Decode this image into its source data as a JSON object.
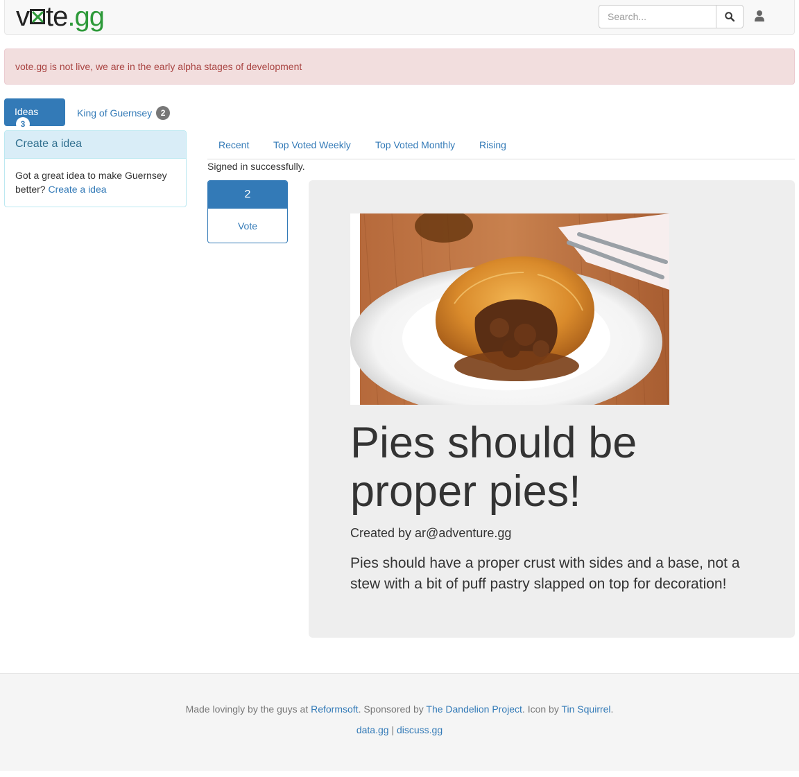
{
  "navbar": {
    "logo_prefix": "v",
    "logo_suffix": "te",
    "logo_tld": ".gg",
    "search_placeholder": "Search...",
    "search_icon": "search-icon",
    "user_icon": "user-icon"
  },
  "alert": {
    "message": "vote.gg is not live, we are in the early alpha stages of development"
  },
  "pills": {
    "ideas_label": "Ideas",
    "ideas_count": "3",
    "king_label": "King of Guernsey",
    "king_count": "2"
  },
  "sidebar": {
    "heading": "Create a idea",
    "body_text": "Got a great idea to make Guernsey better?",
    "body_link": "Create a idea"
  },
  "sort_tabs": {
    "recent": "Recent",
    "top_weekly": "Top Voted Weekly",
    "top_monthly": "Top Voted Monthly",
    "rising": "Rising"
  },
  "flash": "Signed in successfully.",
  "vote": {
    "count": "2",
    "label": "Vote"
  },
  "idea": {
    "title": "Pies should be proper pies!",
    "author": "Created by ar@adventure.gg",
    "description": "Pies should have a proper crust with sides and a base, not a stew with a bit of puff pastry slapped on top for decoration!"
  },
  "footer": {
    "made_by": "Made lovingly by the guys at ",
    "reformsoft": "Reformsoft",
    "sponsored": ". Sponsored by ",
    "dandelion": "The Dandelion Project",
    "icon_by": ". Icon by ",
    "tin_squirrel": "Tin Squirrel",
    "period": ".",
    "data_gg": "data.gg",
    "separator": " | ",
    "discuss_gg": "discuss.gg"
  },
  "colors": {
    "brand_green": "#2e9a3a",
    "primary": "#337ab7",
    "alert_bg": "#f2dede",
    "alert_text": "#a94442",
    "panel_heading_bg": "#d9edf7",
    "jumbotron_bg": "#eeeeee"
  }
}
